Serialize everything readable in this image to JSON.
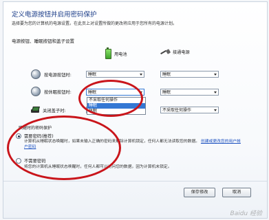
{
  "header": {
    "title": "定义电源按钮并启用密码保护",
    "description": "选择要为您的计算机的电源设置。在此页上对设置所做的更改将应用于您所有的电源计划。"
  },
  "power_settings": {
    "section_title": "电源按钮、睡眠按钮和盖子设置",
    "columns": [
      "用电池",
      "接通电源"
    ],
    "rows": [
      {
        "label": "按电源按钮时:",
        "battery": "睡眠",
        "plugged": "睡眠"
      },
      {
        "label": "按休眠按钮时:",
        "battery": "睡眠",
        "plugged": "睡眠"
      },
      {
        "label": "关闭盖子时:",
        "battery": "睡眠",
        "plugged": "不采取任何操作"
      }
    ]
  },
  "dropdown_open": {
    "options": [
      "不采取任何操作",
      "睡眠",
      "休眠"
    ],
    "highlighted_index": 1
  },
  "password": {
    "section_title": "唤醒时的密码保护",
    "options": [
      {
        "label": "需要密码(推荐)",
        "selected": true,
        "desc_prefix": "计算机从睡眠状态唤醒时，如果未输入正确的密码来解除计算机锁定，任何人都无法读取您的数据。",
        "link": "创建或更改您的用户帐户密码"
      },
      {
        "label": "不需要密码",
        "selected": false,
        "desc_prefix": "将您的计算机从睡眠状态唤醒时，任何人都可以访问您的数据，因为计算机未锁定。"
      }
    ]
  },
  "buttons": {
    "save": "保存修改",
    "cancel": "取消"
  },
  "watermark": "Baidu 经验",
  "colors": {
    "title": "#1e3f8a",
    "highlight": "#3478d4",
    "annotation_ring": "#c9151b"
  }
}
